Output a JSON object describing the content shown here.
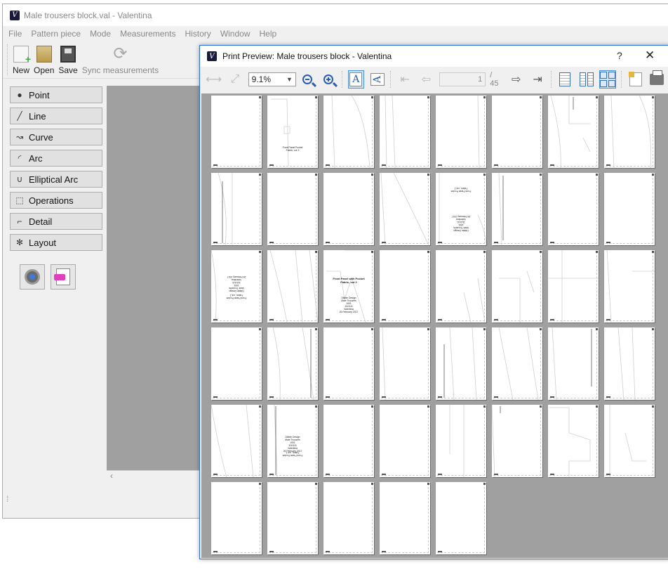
{
  "main_window": {
    "title": "Male trousers block.val - Valentina",
    "menu": [
      "File",
      "Pattern piece",
      "Mode",
      "Measurements",
      "History",
      "Window",
      "Help"
    ],
    "toolbar": {
      "new_label": "New",
      "open_label": "Open",
      "save_label": "Save",
      "sync_label": "Sync measurements"
    },
    "tools": [
      {
        "label": "Point",
        "icon": "point-icon"
      },
      {
        "label": "Line",
        "icon": "line-icon"
      },
      {
        "label": "Curve",
        "icon": "curve-icon"
      },
      {
        "label": "Arc",
        "icon": "arc-icon"
      },
      {
        "label": "Elliptical Arc",
        "icon": "elliptical-arc-icon"
      },
      {
        "label": "Operations",
        "icon": "operations-icon"
      },
      {
        "label": "Detail",
        "icon": "detail-icon"
      },
      {
        "label": "Layout",
        "icon": "layout-icon"
      }
    ]
  },
  "print_preview": {
    "title": "Print Preview: Male trousers block - Valentina",
    "help_label": "?",
    "close_label": "✕",
    "zoom_value": "9.1%",
    "current_page": "1",
    "total_pages": "/ 45",
    "pages_shown": 45,
    "page_labels": {
      "front_pocket_small": "Front Panel Pocket\nFabric, cut 2",
      "front_panel_title": "Front Panel with Pocket\nFabric, cut 2",
      "front_panel_info": "Dibble Design\nMale Trousers\n1001\n1111111\nValentina\n26 February 2017"
    }
  },
  "colors": {
    "dialog_border": "#2b6ee3",
    "preview_background": "#a0a0a0",
    "zoom_icon": "#2a5db0"
  }
}
